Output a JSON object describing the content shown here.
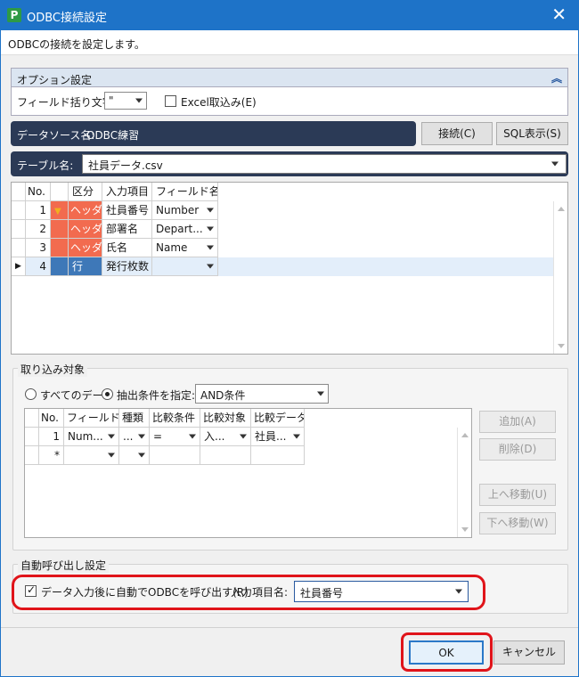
{
  "window": {
    "title": "ODBC接続設定",
    "app_icon_letter": "P",
    "close_glyph": "✕"
  },
  "description": "ODBCの接続を設定します。",
  "options": {
    "header": "オプション設定",
    "quote_label": "フィールド括り文字:",
    "quote_value": "\"",
    "excel_label": "Excel取込み(E)",
    "excel_checked": false
  },
  "datasource": {
    "label": "データソース名:",
    "value": "ODBC練習",
    "connect_btn": "接続(C)",
    "sql_btn": "SQL表示(S)"
  },
  "table": {
    "label": "テーブル名:",
    "value": "社員データ.csv"
  },
  "field_grid": {
    "headers": [
      "No.",
      "区分",
      "入力項目",
      "フィールド名"
    ],
    "rows": [
      {
        "no": "1",
        "kubun": "ヘッダ",
        "item": "社員番号",
        "field": "Number"
      },
      {
        "no": "2",
        "kubun": "ヘッダ",
        "item": "部署名",
        "field": "Depart..."
      },
      {
        "no": "3",
        "kubun": "ヘッダ",
        "item": "氏名",
        "field": "Name"
      },
      {
        "no": "4",
        "kubun": "行",
        "item": "発行枚数",
        "field": ""
      }
    ]
  },
  "import": {
    "legend": "取り込み対象",
    "all_label": "すべてのデータ",
    "cond_label": "抽出条件を指定:",
    "selected": "cond",
    "cond_value": "AND条件",
    "headers": [
      "No.",
      "フィールド名",
      "種類",
      "比較条件",
      "比較対象",
      "比較データ"
    ],
    "rows": [
      {
        "no": "1",
        "field": "Num...",
        "kind": "...",
        "cmp": "=",
        "target": "入...",
        "data": "社員..."
      },
      {
        "no": "*",
        "field": "",
        "kind": "",
        "cmp": "",
        "target": "",
        "data": ""
      }
    ],
    "buttons": {
      "add": "追加(A)",
      "delete": "削除(D)",
      "up": "上へ移動(U)",
      "down": "下へ移動(W)"
    }
  },
  "auto": {
    "legend": "自動呼び出し設定",
    "check_label": "データ入力後に自動でODBCを呼び出す(R)",
    "checked": true,
    "item_label": "入力項目名:",
    "item_value": "社員番号"
  },
  "footer": {
    "ok": "OK",
    "cancel": "キャンセル"
  },
  "colors": {
    "titlebar": "#1e73c8",
    "header_fill": "#f26b4f",
    "row_fill": "#3e78b8",
    "dark_bar": "#2b3a56",
    "highlight": "#e0141a"
  }
}
